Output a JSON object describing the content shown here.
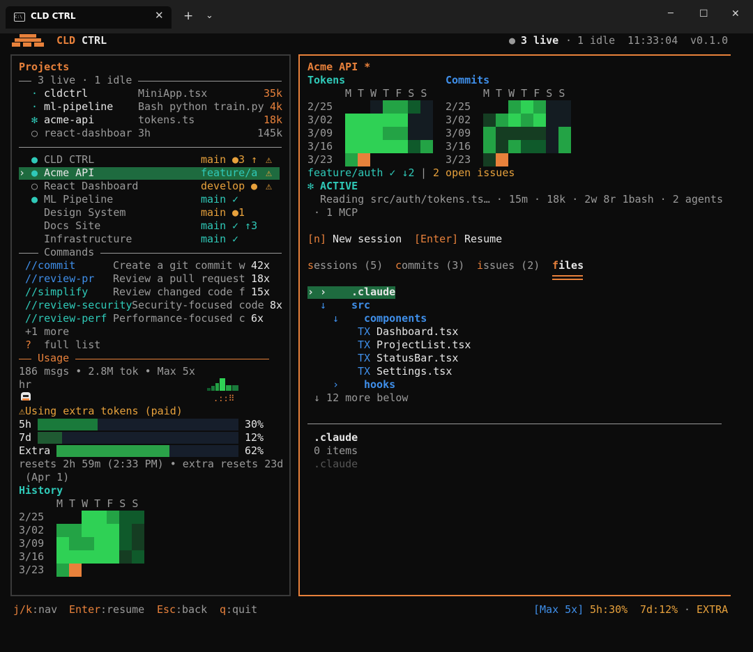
{
  "window": {
    "tab_title": "CLD CTRL",
    "new_tab": "+",
    "dropdown": "⌄",
    "minimize": "─",
    "maximize": "☐",
    "close": "✕"
  },
  "header": {
    "app_name_1": "CLD",
    "app_name_2": "CTRL",
    "live": "3 live",
    "sep": "·",
    "idle": "1 idle",
    "time": "11:33:04",
    "version": "v0.1.0"
  },
  "projects": {
    "title": "Projects",
    "summary": "3 live · 1 idle",
    "active": [
      {
        "marker": "·",
        "name": "cldctrl",
        "detail": "MiniApp.tsx",
        "tokens": "35k"
      },
      {
        "marker": "·",
        "name": "ml-pipeline",
        "detail": "Bash python train.py",
        "tokens": "4k"
      },
      {
        "marker": "✻",
        "name": "acme-api",
        "detail": "tokens.ts",
        "tokens": "18k"
      },
      {
        "marker": "○",
        "name": "react-dashboar",
        "detail": "3h",
        "tokens": "145k"
      }
    ],
    "list": [
      {
        "cursor": "",
        "dot": "●",
        "name": "CLD CTRL",
        "branch": "main",
        "extra": "●3 ↑",
        "warn": "⚠"
      },
      {
        "cursor": "›",
        "dot": "●",
        "name": "Acme API",
        "branch": "feature/a",
        "extra": "",
        "warn": "⚠"
      },
      {
        "cursor": "",
        "dot": "○",
        "name": "React Dashboard",
        "branch": "develop",
        "extra": "●",
        "warn": "⚠"
      },
      {
        "cursor": "",
        "dot": "●",
        "name": "ML Pipeline",
        "branch": "main",
        "extra": "✓",
        "warn": ""
      },
      {
        "cursor": "",
        "dot": "",
        "name": "Design System",
        "branch": "main",
        "extra": "●1",
        "warn": ""
      },
      {
        "cursor": "",
        "dot": "",
        "name": "Docs Site",
        "branch": "main",
        "extra": "✓ ↑3",
        "warn": ""
      },
      {
        "cursor": "",
        "dot": "",
        "name": "Infrastructure",
        "branch": "main",
        "extra": "✓",
        "warn": ""
      }
    ]
  },
  "commands": {
    "title": "Commands",
    "items": [
      {
        "cmd": "//commit",
        "desc": "Create a git commit w",
        "count": "42x"
      },
      {
        "cmd": "//review-pr",
        "desc": "Review a pull request",
        "count": "18x"
      },
      {
        "cmd": "//simplify",
        "desc": "Review changed code f",
        "count": "15x"
      },
      {
        "cmd": "//review-security",
        "desc": "Security-focused code",
        "count": "8x"
      },
      {
        "cmd": "//review-perf",
        "desc": "Performance-focused c",
        "count": "6x"
      }
    ],
    "more": "+1 more",
    "help_key": "?",
    "help_label": "full list"
  },
  "usage": {
    "title": "Usage",
    "summary": "186 msgs • 2.8M tok • Max 5x",
    "hr_label": "hr",
    "sparkline": ".::⠿",
    "warning": "⚠Using extra tokens (paid)",
    "bars": [
      {
        "label": "5h",
        "pct_text": "30%",
        "pct": 0.3,
        "color": "#1a7a3b"
      },
      {
        "label": "7d",
        "pct_text": "12%",
        "pct": 0.12,
        "color": "#1f5a32"
      },
      {
        "label": "Extra",
        "pct_text": "62%",
        "pct": 0.62,
        "color": "#2aa148"
      }
    ],
    "resets": "resets 2h 59m (2:33 PM) • extra resets 23d",
    "resets2": " (Apr 1)"
  },
  "history": {
    "title": "History",
    "days": "M T W T F S S",
    "weeks": [
      "2/25",
      "3/02",
      "3/09",
      "3/16",
      "3/23"
    ]
  },
  "detail": {
    "title": "Acme API *",
    "tokens_title": "Tokens",
    "commits_title": "Commits",
    "days": "M T W T F S S",
    "weeks": [
      "2/25",
      "3/02",
      "3/09",
      "3/16",
      "3/23"
    ],
    "branch": "feature/auth ✓ ↓2",
    "pipe": "|",
    "issues": "2 open issues",
    "status_icon": "✻",
    "status": "ACTIVE",
    "activity_1": "Reading src/auth/tokens.ts… · 15m · 18k · 2w 8r 1bash · 2 agents",
    "activity_2": "· 1 MCP",
    "actions": [
      {
        "key": "[n]",
        "label": "New session"
      },
      {
        "key": "[Enter]",
        "label": "Resume"
      }
    ],
    "tabs": [
      {
        "hot": "s",
        "rest": "essions (5)"
      },
      {
        "hot": "c",
        "rest": "ommits (3)"
      },
      {
        "hot": "i",
        "rest": "ssues (2)"
      },
      {
        "hot": "f",
        "rest": "iles"
      }
    ]
  },
  "files": {
    "tree": [
      {
        "prefix": "› ›",
        "name": ".claude",
        "kind": "dir-selected"
      },
      {
        "prefix": "↓",
        "name": "src",
        "kind": "dir"
      },
      {
        "prefix": "↓",
        "name": "components",
        "kind": "dir"
      },
      {
        "prefix": "TX",
        "name": "Dashboard.tsx",
        "kind": "file"
      },
      {
        "prefix": "TX",
        "name": "ProjectList.tsx",
        "kind": "file"
      },
      {
        "prefix": "TX",
        "name": "StatusBar.tsx",
        "kind": "file"
      },
      {
        "prefix": "TX",
        "name": "Settings.tsx",
        "kind": "file"
      },
      {
        "prefix": "›",
        "name": "hooks",
        "kind": "dir"
      }
    ],
    "more": "↓ 12 more below",
    "preview_name": ".claude",
    "preview_count": "0 items",
    "preview_faded": ".claude"
  },
  "footer": {
    "hints": [
      {
        "key": "j/k",
        "label": ":nav"
      },
      {
        "key": "Enter",
        "label": ":resume"
      },
      {
        "key": "Esc",
        "label": ":back"
      },
      {
        "key": "q",
        "label": ":quit"
      }
    ],
    "plan": "[Max 5x]",
    "h5": "5h:30%",
    "d7": "7d:12%",
    "sep": "·",
    "extra": "EXTRA"
  },
  "colors": {
    "bg": "#0c0c0c",
    "accent": "#e8813b",
    "teal": "#2fc9b8",
    "blue": "#3f8fea",
    "green_hi": "#2fd155",
    "green_mid": "#23a345",
    "green_dark": "#0f5a2b",
    "green_deep": "#153d22",
    "empty": "#141c22",
    "today": "#e8813b"
  }
}
